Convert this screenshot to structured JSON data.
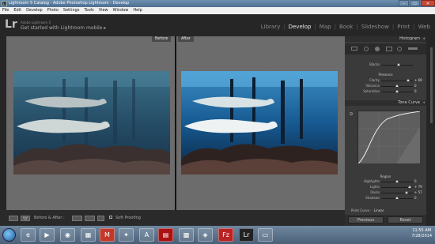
{
  "window": {
    "title": "Lightroom 5 Catalog - Adobe Photoshop Lightroom - Develop",
    "app_icon": "Lr",
    "btn_min": "–",
    "btn_max": "▭",
    "btn_close": "✕"
  },
  "menu": [
    "File",
    "Edit",
    "Develop",
    "Photo",
    "Settings",
    "Tools",
    "View",
    "Window",
    "Help"
  ],
  "identity": {
    "logo": "Lr",
    "subtitle": "Adobe Lightroom 5",
    "text": "Get started with Lightroom mobile",
    "arrow": "▸"
  },
  "modules": [
    "Library",
    "Develop",
    "Map",
    "Book",
    "Slideshow",
    "Print",
    "Web"
  ],
  "module_separator": "|",
  "active_module": "Develop",
  "view": {
    "before_label": "Before",
    "after_label": "After"
  },
  "toolbar": {
    "before_after": "Before & After :",
    "soft_proofing": "Soft Proofing",
    "view_mode": "Y|Y"
  },
  "panel": {
    "histogram": "Histogram",
    "blacks_label": "Blacks",
    "presence": "Presence",
    "clarity": "Clarity",
    "clarity_value": "+ 69",
    "vibrance": "Vibrance",
    "vibrance_value": "0",
    "saturation": "Saturation",
    "saturation_value": "0",
    "tone_curve": "Tone Curve",
    "region": "Region",
    "highlights": "Highlights",
    "highlights_value": "0",
    "lights": "Lights",
    "lights_value": "+ 79",
    "darks": "Darks",
    "darks_value": "+ 57",
    "shadows": "Shadows",
    "shadows_value": "0",
    "point_curve": "Point Curve :",
    "point_curve_value": "Linear",
    "previous": "Previous",
    "reset": "Reset"
  },
  "taskbar": {
    "time": "11:55 AM",
    "date": "7/28/2014",
    "icons": [
      "e",
      "▶",
      "◉",
      "▦",
      "M",
      "✦",
      "A",
      "▤",
      "▩",
      "◈",
      "Fz",
      "Lr",
      "▭"
    ]
  },
  "colors": {
    "accent": "#e8e8e8",
    "panel_bg": "#3a3a3a",
    "view_bg": "#6c6c6c"
  }
}
